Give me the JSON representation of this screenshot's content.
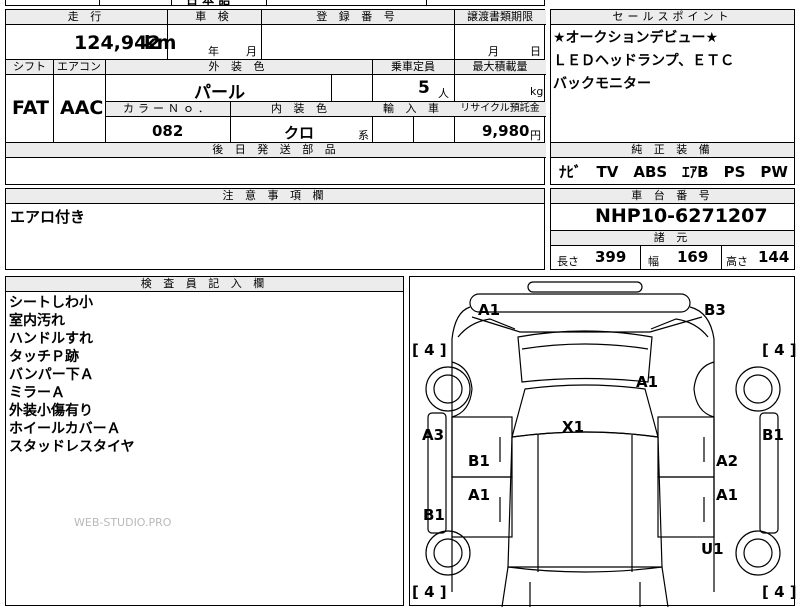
{
  "top_strip": {
    "partial_title": "日 本 語"
  },
  "mileage": {
    "header": "走 行",
    "value": "124,942",
    "unit": "km"
  },
  "inspection": {
    "header": "車 検",
    "year_unit": "年",
    "month_unit": "月"
  },
  "registration": {
    "header": "登 録 番 号"
  },
  "transfer_deadline": {
    "header": "譲渡書類期限",
    "month_unit": "月",
    "day_unit": "日"
  },
  "shift": {
    "header": "シフト",
    "value": "FAT"
  },
  "aircon": {
    "header": "エアコン",
    "value": "AAC"
  },
  "exterior_color": {
    "header": "外 装 色",
    "value": "パール"
  },
  "capacity": {
    "header": "乗車定員",
    "value": "5",
    "unit": "人"
  },
  "max_load": {
    "header": "最大積載量",
    "unit": "kg"
  },
  "color_no": {
    "header": "カラーＮｏ．",
    "value": "082"
  },
  "interior_color": {
    "header": "内 装 色",
    "value": "クロ",
    "unit": "系"
  },
  "import": {
    "header": "輸 入 車"
  },
  "recycle": {
    "header": "リサイクル預託金",
    "value": "9,980",
    "unit": "円"
  },
  "delayed_parts": {
    "header": "後 日 発 送 部 品"
  },
  "sales_points": {
    "header": "セールスポイント",
    "lines": [
      "★オークションデビュー★",
      "ＬＥＤヘッドランプ、ＥＴＣ",
      "バックモニター"
    ]
  },
  "genuine_equipment": {
    "header": "純 正 装 備",
    "value": "ﾅﾋﾞ　TV　ABS　ｴｱB　PS　PW"
  },
  "notes": {
    "header": "注 意 事 項 欄",
    "text": "エアロ付き"
  },
  "chassis": {
    "header": "車 台 番 号",
    "value": "NHP10-6271207"
  },
  "specs": {
    "header": "諸 元",
    "length_label": "長さ",
    "length": "399",
    "width_label": "幅",
    "width": "169",
    "height_label": "高さ",
    "height": "144"
  },
  "inspector": {
    "header": "検 査 員 記 入 欄",
    "lines": [
      "シートしわ小",
      "室内汚れ",
      "ハンドルすれ",
      "タッチＰ跡",
      "バンパー下Ａ",
      "ミラーＡ",
      "外装小傷有り",
      "ホイールカバーＡ",
      "スタッドレスタイヤ"
    ]
  },
  "watermark": "WEB-STUDIO.PRO",
  "damage_marks": {
    "front_left": "A1",
    "front_right": "B3",
    "hood": "A1",
    "windshield": "X1",
    "left_fender": "A3",
    "right_fender": "B1",
    "left_front_door": "B1",
    "right_front_door": "A2",
    "left_rear_door": "A1",
    "right_rear_door": "A1",
    "left_quarter": "B1",
    "right_quarter": "U1"
  },
  "tire_marks": {
    "front_left": "[ 4 ]",
    "front_right": "[ 4 ]",
    "rear_left": "[ 4 ]",
    "rear_right": "[ 4 ]"
  }
}
